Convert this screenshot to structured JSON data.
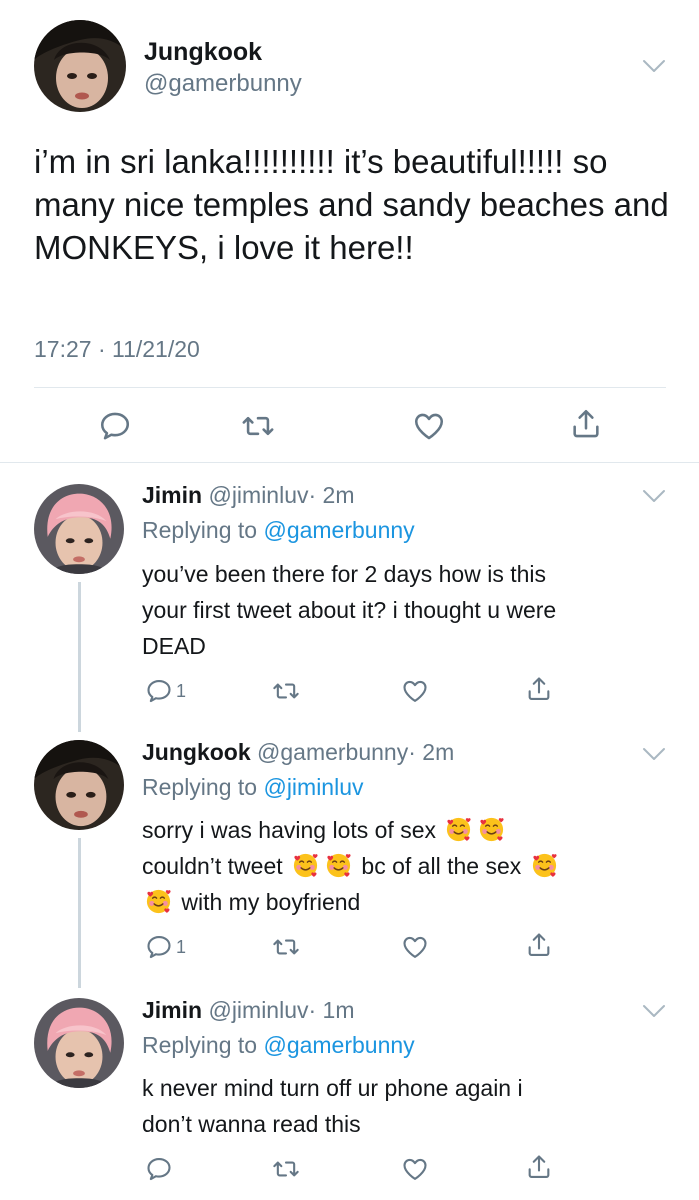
{
  "main_tweet": {
    "name": "Jungkook",
    "handle": "@gamerbunny",
    "text": "i’m in sri lanka!!!!!!!!!! it’s beautiful!!!!! so many nice temples and sandy beaches and MONKEYS, i love it here!!",
    "timestamp": "17:27 · 11/21/20"
  },
  "replies": [
    {
      "name": "Jimin",
      "handle": "@jiminluv",
      "time": "· 2m",
      "replying_prefix": "Replying to",
      "replying_to": "@gamerbunny",
      "text_lines": [
        "you’ve been there for 2 days how is this",
        "your first tweet about it? i thought u were",
        "DEAD"
      ],
      "reply_count": "1"
    },
    {
      "name": "Jungkook",
      "handle": "@gamerbunny",
      "time": "· 2m",
      "replying_prefix": "Replying to",
      "replying_to": "@jiminluv",
      "text_parts": [
        "sorry i was having lots of sex",
        "couldn’t tweet",
        "bc of all the sex",
        "with my boyfriend"
      ],
      "reply_count": "1"
    },
    {
      "name": "Jimin",
      "handle": "@jiminluv",
      "time": "· 1m",
      "replying_prefix": "Replying to",
      "replying_to": "@gamerbunny",
      "text_lines": [
        "k never mind turn off ur phone again i",
        "don’t wanna read this"
      ],
      "reply_count": ""
    }
  ],
  "icons": [
    "chevron-down-icon",
    "reply-icon",
    "retweet-icon",
    "like-icon",
    "share-icon",
    "smiling-face-with-hearts-emoji"
  ],
  "colors": {
    "link": "#1b95e0",
    "secondary_text": "#657786",
    "divider": "#e1e8ed",
    "thread_line": "#ccd6dd"
  }
}
